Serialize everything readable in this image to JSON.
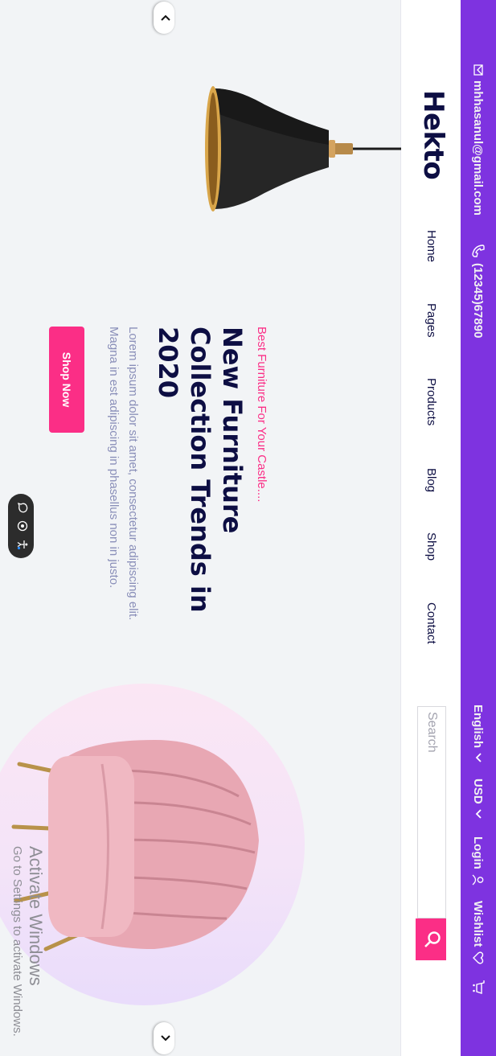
{
  "topbar": {
    "email": "mhhasanul@gmail.com",
    "phone": "(12345)67890",
    "language": "English",
    "currency": "USD",
    "login": "Login",
    "wishlist": "Wishlist",
    "icons": [
      "mail-icon",
      "phone-icon",
      "chevron-down-icon",
      "user-icon",
      "heart-icon",
      "cart-icon"
    ],
    "color": "#7e33e0"
  },
  "header": {
    "logo": "Hekto",
    "nav": [
      "Home",
      "Pages",
      "Products",
      "Blog",
      "Shop",
      "Contact"
    ],
    "search_placeholder": "Search",
    "search_icon": "search-icon"
  },
  "hero": {
    "subtitle": "Best Furniture For Your Castle....",
    "title": "New Furniture Collection Trends in 2020",
    "description": "Lorem ipsum dolor sit amet, consectetur adipiscing elit. Magna in est adipiscing in phasellus non in justo.",
    "button": "Shop Now",
    "accent": "#fb2e86",
    "heading_color": "#0d0e43"
  },
  "watermark": {
    "line1": "Activate Windows",
    "line2": "Go to Settings to activate Windows."
  }
}
